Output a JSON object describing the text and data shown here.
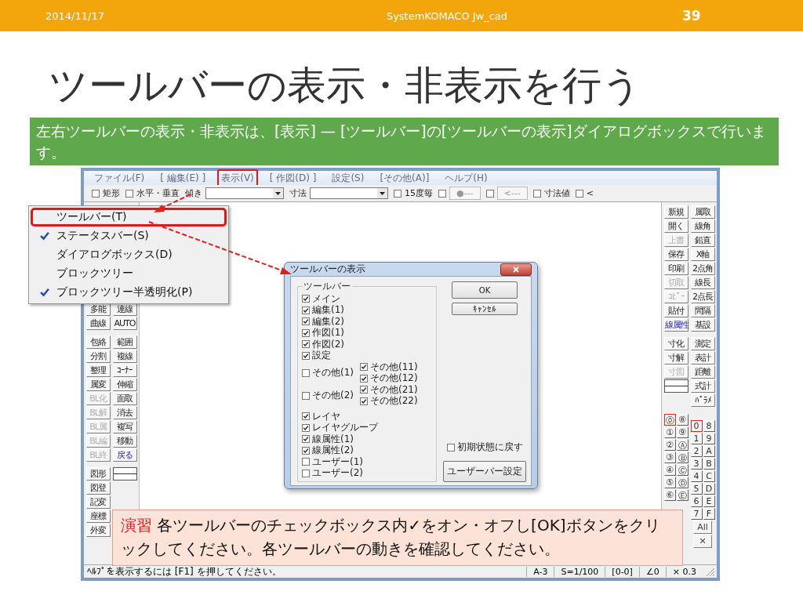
{
  "slide": {
    "date": "2014/11/17",
    "footer": "SystemKOMACO Jw_cad",
    "page": "39",
    "title": "ツールバーの表示・非表示を行う",
    "callout": "左右ツールバーの表示・非表示は、[表示] — [ツールバー]の[ツールバーの表示]ダイアログボックスで行います。"
  },
  "menu_bar": [
    {
      "label": "ファイル(F)",
      "highlighted": false
    },
    {
      "label": "[ 編集(E) ]",
      "highlighted": false
    },
    {
      "label": "表示(V)",
      "highlighted": true
    },
    {
      "label": "[ 作図(D) ]",
      "highlighted": false
    },
    {
      "label": "設定(S)",
      "highlighted": false
    },
    {
      "label": "[その他(A)]",
      "highlighted": false
    },
    {
      "label": "ヘルプ(H)",
      "highlighted": false
    }
  ],
  "toolbar": [
    {
      "kind": "check",
      "label": "矩形",
      "checked": false
    },
    {
      "kind": "check",
      "label": "水平・垂直",
      "checked": false
    },
    {
      "kind": "combo",
      "label": "傾き"
    },
    {
      "kind": "combo",
      "label": "寸法"
    },
    {
      "kind": "check",
      "label": "15度毎",
      "checked": false
    },
    {
      "kind": "check_button",
      "label": "●---",
      "checked": false
    },
    {
      "kind": "check_button",
      "label": "<---",
      "checked": false
    },
    {
      "kind": "check",
      "label": "寸法値",
      "checked": false
    },
    {
      "kind": "check",
      "label": "<",
      "checked": false
    }
  ],
  "left_palette": [
    [
      [
        {
          "kind": "button",
          "label": "多能",
          "disabled": false
        },
        {
          "kind": "button",
          "label": "連線",
          "disabled": false
        }
      ],
      [
        {
          "kind": "button",
          "label": "曲線",
          "disabled": false
        },
        {
          "kind": "button",
          "label": "AUTO",
          "disabled": false
        }
      ]
    ],
    [
      [
        {
          "kind": "button",
          "label": "包絡",
          "disabled": false
        },
        {
          "kind": "button",
          "label": "範囲",
          "disabled": false
        }
      ],
      [
        {
          "kind": "button",
          "label": "分割",
          "disabled": false
        },
        {
          "kind": "button",
          "label": "複線",
          "disabled": false
        }
      ],
      [
        {
          "kind": "button",
          "label": "整理",
          "disabled": false
        },
        {
          "kind": "button",
          "label": "ｺｰﾅｰ",
          "disabled": false
        }
      ],
      [
        {
          "kind": "button",
          "label": "属変",
          "disabled": false
        },
        {
          "kind": "button",
          "label": "伸縮",
          "disabled": false
        }
      ],
      [
        {
          "kind": "button",
          "label": "BL化",
          "disabled": true
        },
        {
          "kind": "button",
          "label": "面取",
          "disabled": false
        }
      ],
      [
        {
          "kind": "button",
          "label": "BL解",
          "disabled": true
        },
        {
          "kind": "button",
          "label": "消去",
          "disabled": false
        }
      ],
      [
        {
          "kind": "button",
          "label": "BL属",
          "disabled": true
        },
        {
          "kind": "button",
          "label": "複写",
          "disabled": false
        }
      ],
      [
        {
          "kind": "button",
          "label": "BL編",
          "disabled": true
        },
        {
          "kind": "button",
          "label": "移動",
          "disabled": false
        }
      ],
      [
        {
          "kind": "button",
          "label": "BL終",
          "disabled": true
        },
        {
          "kind": "accent_button",
          "label": "戻る",
          "disabled": false
        }
      ]
    ],
    [
      [
        {
          "kind": "button",
          "label": "図形",
          "disabled": false
        },
        {
          "kind": "swatch"
        }
      ],
      [
        {
          "kind": "button",
          "label": "図登",
          "disabled": false
        }
      ],
      [
        {
          "kind": "button",
          "label": "記変",
          "disabled": false
        }
      ],
      [
        {
          "kind": "button",
          "label": "座標",
          "disabled": false
        }
      ],
      [
        {
          "kind": "button",
          "label": "外変",
          "disabled": false
        }
      ]
    ]
  ],
  "right_palette": [
    [
      [
        {
          "kind": "button",
          "label": "新規",
          "disabled": false
        },
        {
          "kind": "button",
          "label": "属取",
          "disabled": false
        }
      ],
      [
        {
          "kind": "button",
          "label": "開く",
          "disabled": false
        },
        {
          "kind": "button",
          "label": "線角",
          "disabled": false
        }
      ],
      [
        {
          "kind": "button",
          "label": "上書",
          "disabled": true
        },
        {
          "kind": "button",
          "label": "鉛直",
          "disabled": false
        }
      ],
      [
        {
          "kind": "button",
          "label": "保存",
          "disabled": false
        },
        {
          "kind": "button",
          "label": "X軸",
          "disabled": false
        }
      ],
      [
        {
          "kind": "button",
          "label": "印刷",
          "disabled": false
        },
        {
          "kind": "button",
          "label": "2点角",
          "disabled": false
        }
      ],
      [
        {
          "kind": "button",
          "label": "切取",
          "disabled": true
        },
        {
          "kind": "button",
          "label": "線長",
          "disabled": false
        }
      ],
      [
        {
          "kind": "button",
          "label": "ｺﾋﾟｰ",
          "disabled": true
        },
        {
          "kind": "button",
          "label": "2点長",
          "disabled": false
        }
      ],
      [
        {
          "kind": "button",
          "label": "貼付",
          "disabled": false
        },
        {
          "kind": "button",
          "label": "間隔",
          "disabled": false
        }
      ],
      [
        {
          "kind": "accent_button",
          "label": "線属性",
          "disabled": false
        },
        {
          "kind": "button",
          "label": "基設",
          "disabled": false
        }
      ]
    ],
    [
      [
        {
          "kind": "button",
          "label": "寸化",
          "disabled": false
        },
        {
          "kind": "button",
          "label": "測定",
          "disabled": false
        }
      ],
      [
        {
          "kind": "button",
          "label": "寸解",
          "disabled": false
        },
        {
          "kind": "button",
          "label": "表計",
          "disabled": false
        }
      ],
      [
        {
          "kind": "button",
          "label": "寸図",
          "disabled": true
        },
        {
          "kind": "button",
          "label": "距離",
          "disabled": false
        }
      ],
      [
        {
          "kind": "swatch"
        },
        {
          "kind": "button",
          "label": "式計",
          "disabled": false
        }
      ],
      [
        {
          "kind": "blank"
        },
        {
          "kind": "button",
          "label": "ﾊﾟﾗﾒ",
          "disabled": false
        }
      ]
    ]
  ],
  "layer_groups": [
    {
      "label": "⓪",
      "selected": true
    },
    {
      "label": "⑧",
      "selected": false
    },
    {
      "label": "①",
      "selected": false
    },
    {
      "label": "⑨",
      "selected": false
    },
    {
      "label": "②",
      "selected": false
    },
    {
      "label": "Ⓐ",
      "selected": false
    },
    {
      "label": "③",
      "selected": false
    },
    {
      "label": "Ⓑ",
      "selected": false
    },
    {
      "label": "④",
      "selected": false
    },
    {
      "label": "Ⓒ",
      "selected": false
    },
    {
      "label": "⑤",
      "selected": false
    },
    {
      "label": "Ⓓ",
      "selected": false
    },
    {
      "label": "⑥",
      "selected": false
    },
    {
      "label": "Ⓔ",
      "selected": false
    }
  ],
  "layers": [
    {
      "label": "0",
      "selected": true
    },
    {
      "label": "8",
      "selected": false
    },
    {
      "label": "1",
      "selected": false
    },
    {
      "label": "9",
      "selected": false
    },
    {
      "label": "2",
      "selected": false
    },
    {
      "label": "A",
      "selected": false
    },
    {
      "label": "3",
      "selected": false
    },
    {
      "label": "B",
      "selected": false
    },
    {
      "label": "4",
      "selected": false
    },
    {
      "label": "C",
      "selected": false
    },
    {
      "label": "5",
      "selected": false
    },
    {
      "label": "D",
      "selected": false
    },
    {
      "label": "6",
      "selected": false
    },
    {
      "label": "E",
      "selected": false
    },
    {
      "label": "7",
      "selected": false
    },
    {
      "label": "F",
      "selected": false
    }
  ],
  "layer_buttons": [
    "All",
    "✕"
  ],
  "status_bar": {
    "help": "ﾍﾙﾌﾟを表示するには [F1] を押してください。",
    "cells": [
      "A-3",
      "S=1/100",
      "[0-0]",
      "∠0",
      "× 0.3"
    ]
  },
  "view_menu": [
    {
      "label": "ツールバー(T)",
      "checked": false,
      "highlighted": true
    },
    {
      "label": "ステータスバー(S)",
      "checked": true,
      "highlighted": false
    },
    {
      "label": "ダイアログボックス(D)",
      "checked": false,
      "highlighted": false
    },
    {
      "label": "ブロックツリー",
      "checked": false,
      "highlighted": false
    },
    {
      "label": "ブロックツリー半透明化(P)",
      "checked": true,
      "highlighted": false
    }
  ],
  "dialog": {
    "title": "ツールバーの表示",
    "group": "ツールバー",
    "sections": [
      [
        {
          "label": "メイン",
          "checked": true
        },
        {
          "label": "編集(1)",
          "checked": true
        },
        {
          "label": "編集(2)",
          "checked": true
        },
        {
          "label": "作図(1)",
          "checked": true
        },
        {
          "label": "作図(2)",
          "checked": true
        },
        {
          "label": "設定",
          "checked": true
        },
        {
          "label": "その他(1)",
          "checked": false,
          "sub": [
            {
              "label": "その他(11)",
              "checked": true
            },
            {
              "label": "その他(12)",
              "checked": true
            }
          ]
        },
        {
          "label": "その他(2)",
          "checked": false,
          "sub": [
            {
              "label": "その他(21)",
              "checked": true
            },
            {
              "label": "その他(22)",
              "checked": true
            }
          ]
        }
      ],
      [
        {
          "label": "レイヤ",
          "checked": true
        },
        {
          "label": "レイヤグループ",
          "checked": true
        },
        {
          "label": "線属性(1)",
          "checked": true
        },
        {
          "label": "線属性(2)",
          "checked": true
        },
        {
          "label": "ユーザー(1)",
          "checked": false
        },
        {
          "label": "ユーザー(2)",
          "checked": false
        }
      ]
    ],
    "ok": "OK",
    "cancel": "ｷｬﾝｾﾙ",
    "reset": {
      "label": "初期状態に戻す",
      "checked": false
    },
    "user_bar": "ユーザーバー設定"
  },
  "exercise": {
    "label": "演習",
    "text": "各ツールバーのチェックボックス内✓をオン・オフし[OK]ボタンをクリックしてください。各ツールバーの動きを確認してください。"
  }
}
